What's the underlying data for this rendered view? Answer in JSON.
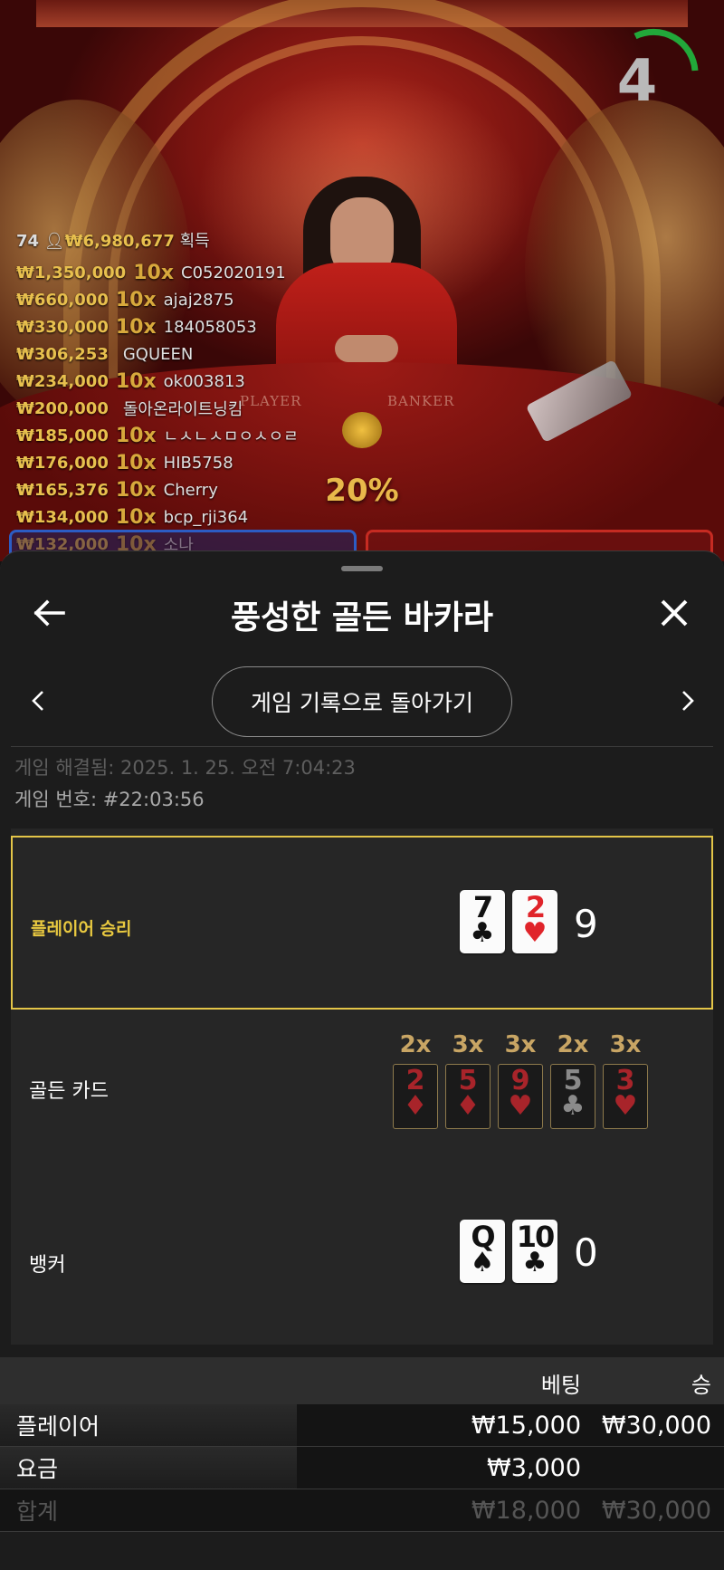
{
  "video": {
    "timer": "4",
    "table_labels": {
      "player": "PLAYER",
      "banker": "BANKER"
    },
    "percent": "20%",
    "winners_header": {
      "count": "74",
      "total": "₩6,980,677",
      "suffix": "획득"
    },
    "winners": [
      {
        "amount": "₩1,350,000",
        "multiplier": "10x",
        "user": "C052020191"
      },
      {
        "amount": "₩660,000",
        "multiplier": "10x",
        "user": "ajaj2875"
      },
      {
        "amount": "₩330,000",
        "multiplier": "10x",
        "user": "184058053"
      },
      {
        "amount": "₩306,253",
        "multiplier": "",
        "user": "GQUEEN"
      },
      {
        "amount": "₩234,000",
        "multiplier": "10x",
        "user": "ok003813"
      },
      {
        "amount": "₩200,000",
        "multiplier": "",
        "user": "돌아온라이트닝킴"
      },
      {
        "amount": "₩185,000",
        "multiplier": "10x",
        "user": "ㄴㅅㄴㅅㅁㅇㅅㅇㄹ"
      },
      {
        "amount": "₩176,000",
        "multiplier": "10x",
        "user": "HIB5758"
      },
      {
        "amount": "₩165,376",
        "multiplier": "10x",
        "user": "Cherry"
      },
      {
        "amount": "₩134,000",
        "multiplier": "10x",
        "user": "bcp_rji364"
      },
      {
        "amount": "₩132,000",
        "multiplier": "10x",
        "user": "소나"
      }
    ]
  },
  "sheet": {
    "title": "풍성한 골든 바카라",
    "history_button": "게임 기록으로 돌아가기",
    "resolved": "게임 해결됨: 2025. 1. 25. 오전 7:04:23",
    "game_number": "게임 번호: #22:03:56"
  },
  "result": {
    "player": {
      "label": "플레이어 승리",
      "cards": [
        {
          "rank": "7",
          "suit": "♣",
          "color": "black"
        },
        {
          "rank": "2",
          "suit": "♥",
          "color": "red"
        }
      ],
      "total": "9"
    },
    "golden": {
      "label": "골든 카드",
      "cards": [
        {
          "mult": "2x",
          "rank": "2",
          "suit": "♦",
          "color": "red"
        },
        {
          "mult": "3x",
          "rank": "5",
          "suit": "♦",
          "color": "red"
        },
        {
          "mult": "3x",
          "rank": "9",
          "suit": "♥",
          "color": "red"
        },
        {
          "mult": "2x",
          "rank": "5",
          "suit": "♣",
          "color": "black"
        },
        {
          "mult": "3x",
          "rank": "3",
          "suit": "♥",
          "color": "red"
        }
      ]
    },
    "banker": {
      "label": "뱅커",
      "cards": [
        {
          "rank": "Q",
          "suit": "♠",
          "color": "black"
        },
        {
          "rank": "10",
          "suit": "♣",
          "color": "black"
        }
      ],
      "total": "0"
    }
  },
  "bets": {
    "header": {
      "bet": "베팅",
      "win": "승"
    },
    "rows": [
      {
        "name": "플레이어",
        "bet": "₩15,000",
        "win": "₩30,000"
      },
      {
        "name": "요금",
        "bet": "₩3,000",
        "win": ""
      }
    ],
    "total": {
      "name": "합계",
      "bet": "₩18,000",
      "win": "₩30,000"
    }
  },
  "colors": {
    "accent_gold": "#e9c940",
    "golden_mult": "#c8a564",
    "timer_green": "#22a83a"
  },
  "icons": {
    "back": "arrow-left-icon",
    "close": "close-icon",
    "prev": "chevron-left-icon",
    "next": "chevron-right-icon"
  }
}
